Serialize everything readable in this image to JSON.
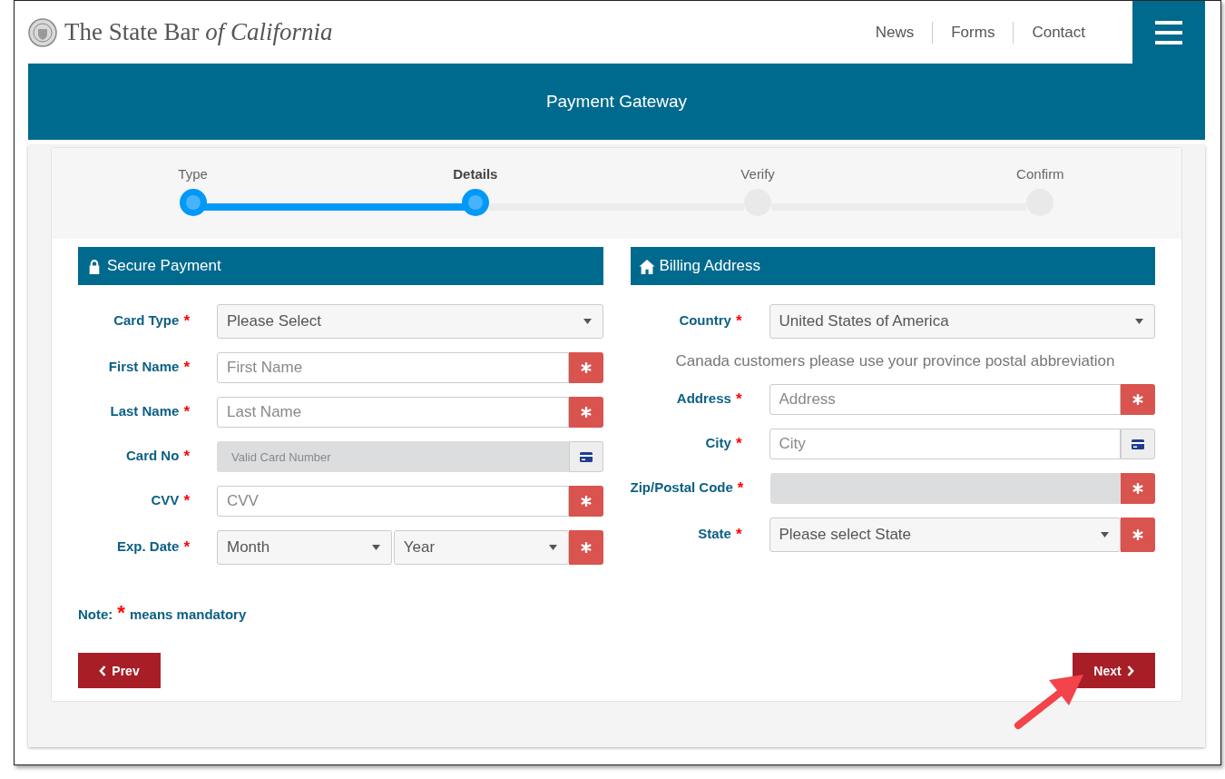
{
  "header": {
    "logo": "The State Bar *of California*",
    "nav": [
      "News",
      "Forms",
      "Contact"
    ]
  },
  "banner": {
    "title": "Payment Gateway"
  },
  "steps": [
    {
      "label": "Type",
      "done": true,
      "selected": false
    },
    {
      "label": "Details",
      "done": true,
      "selected": true
    },
    {
      "label": "Verify",
      "done": false,
      "selected": false
    },
    {
      "label": "Confirm",
      "done": false,
      "selected": false
    }
  ],
  "sections": [
    {
      "title": "Secure Payment",
      "fields": [
        {
          "kind": "select",
          "label": "Card Type",
          "mark": "*",
          "value": "Please Select"
        },
        {
          "kind": "input",
          "label": "First Name",
          "mark": "*",
          "placeholder": "First Name",
          "addon": {
            "kind": "required"
          }
        },
        {
          "kind": "input",
          "label": "Last Name",
          "mark": "*",
          "placeholder": "Last Name",
          "addon": {
            "kind": "required"
          }
        },
        {
          "kind": "input",
          "label": "Card No",
          "mark": "*",
          "placeholder": "Valid Card Number",
          "addon": {
            "kind": "card"
          },
          "disabled": true
        },
        {
          "kind": "input",
          "label": "CVV",
          "mark": "*",
          "placeholder": "CVV",
          "addon": {
            "kind": "required"
          }
        },
        {
          "kind": "date",
          "label": "Exp. Date",
          "mark": "*",
          "selects": [
            "Month",
            "Year"
          ],
          "addon": {
            "kind": "required"
          }
        }
      ]
    },
    {
      "title": "Billing Address",
      "fields": [
        {
          "kind": "select",
          "label": "Country",
          "mark": "*",
          "value": "United States of America"
        },
        {
          "kind": "note",
          "text": "Canada customers please use your province postal abbreviation"
        },
        {
          "kind": "input",
          "label": "Address",
          "mark": "*",
          "placeholder": "Address",
          "addon": {
            "kind": "required"
          }
        },
        {
          "kind": "input",
          "label": "City",
          "mark": "*",
          "placeholder": "City",
          "addon": {
            "kind": "card"
          }
        },
        {
          "kind": "input",
          "label": "Zip/Postal Code",
          "mark": "*",
          "addon": {
            "kind": "required"
          },
          "disabled": true
        },
        {
          "kind": "select",
          "label": "State",
          "mark": "*",
          "value": "Please select State",
          "addon": {
            "kind": "required"
          }
        }
      ]
    }
  ],
  "note": {
    "label": "Note:",
    "mark": "*",
    "text": "means mandatory"
  },
  "buttons": {
    "prev": "Prev",
    "next": "Next"
  }
}
